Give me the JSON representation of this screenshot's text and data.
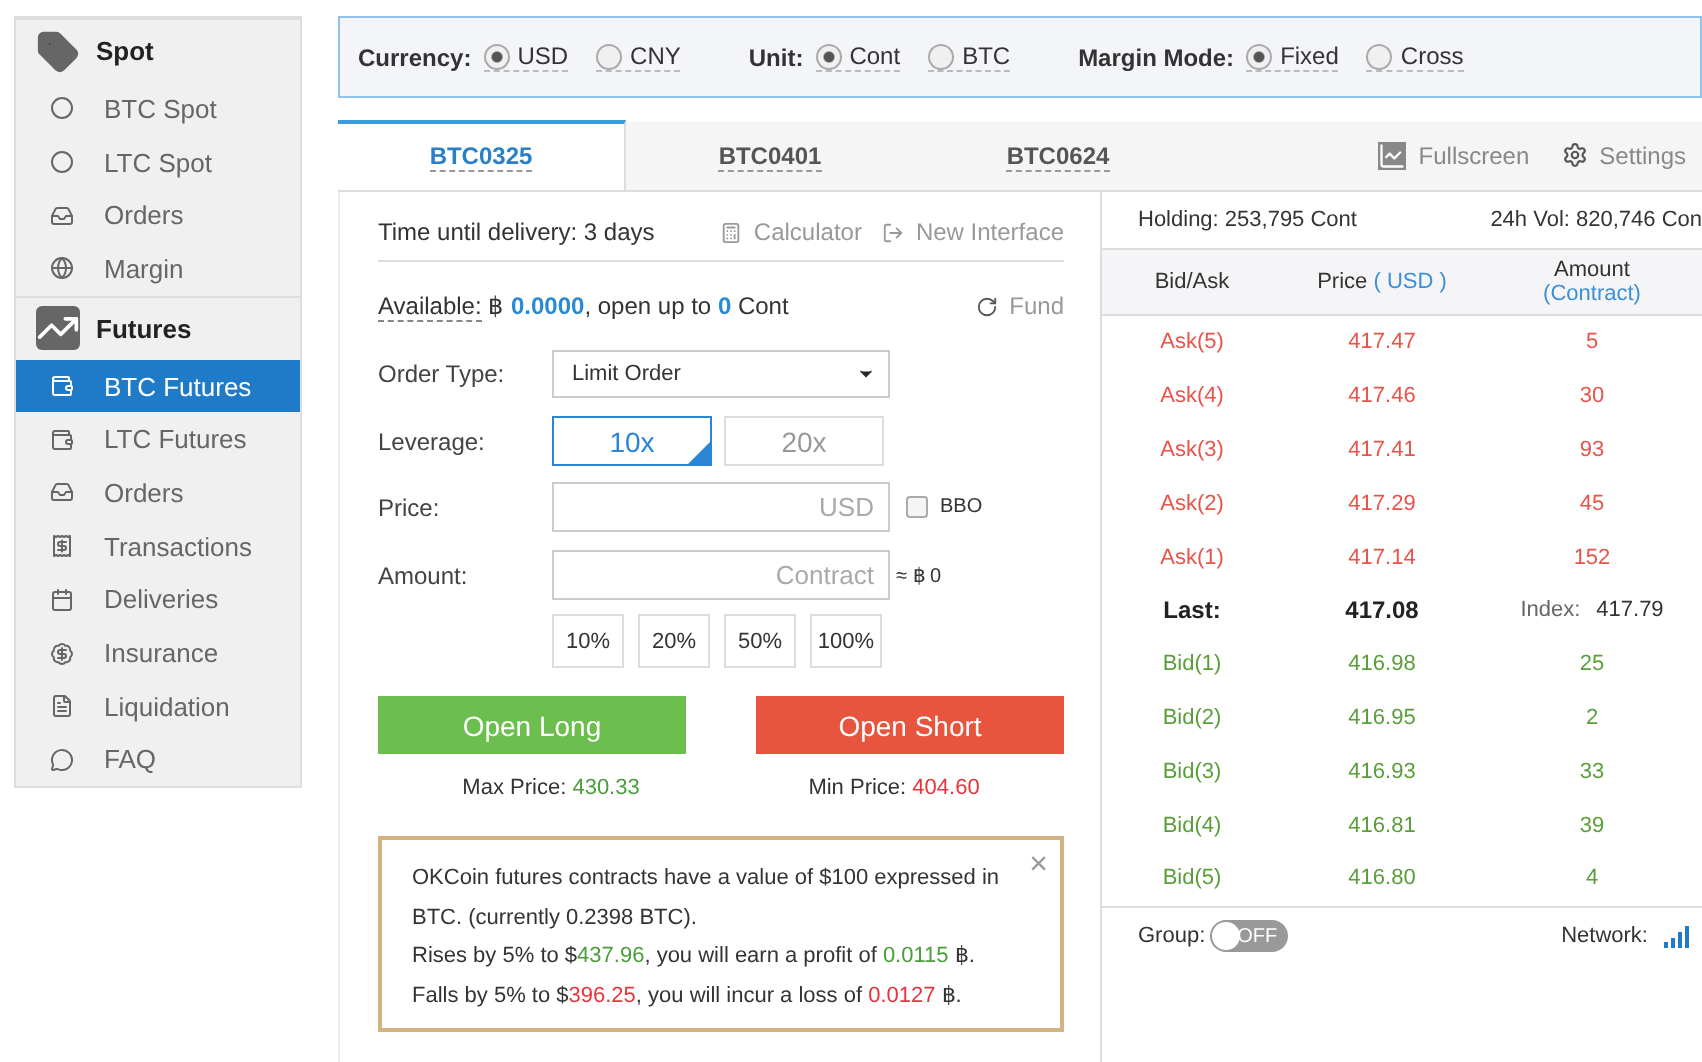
{
  "sidebar": {
    "sections": [
      {
        "title": "Spot",
        "items": [
          {
            "label": "BTC Spot",
            "selected": false
          },
          {
            "label": "LTC Spot",
            "selected": false
          },
          {
            "label": "Orders",
            "selected": false
          },
          {
            "label": "Margin",
            "selected": false
          }
        ]
      },
      {
        "title": "Futures",
        "items": [
          {
            "label": "BTC Futures",
            "selected": true
          },
          {
            "label": "LTC Futures",
            "selected": false
          },
          {
            "label": "Orders",
            "selected": false
          },
          {
            "label": "Transactions",
            "selected": false
          },
          {
            "label": "Deliveries",
            "selected": false
          },
          {
            "label": "Insurance",
            "selected": false
          },
          {
            "label": "Liquidation",
            "selected": false
          },
          {
            "label": "FAQ",
            "selected": false
          }
        ]
      }
    ]
  },
  "options": [
    {
      "label": "Currency:",
      "choices": [
        {
          "label": "USD",
          "selected": true
        },
        {
          "label": "CNY",
          "selected": false
        }
      ]
    },
    {
      "label": "Unit:",
      "choices": [
        {
          "label": "Cont",
          "selected": true
        },
        {
          "label": "BTC",
          "selected": false
        }
      ]
    },
    {
      "label": "Margin Mode:",
      "choices": [
        {
          "label": "Fixed",
          "selected": true
        },
        {
          "label": "Cross",
          "selected": false
        }
      ]
    }
  ],
  "tabs": [
    {
      "label": "BTC0325",
      "selected": true
    },
    {
      "label": "BTC0401",
      "selected": false
    },
    {
      "label": "BTC0624",
      "selected": false
    }
  ],
  "tab_actions": {
    "fullscreen": "Fullscreen",
    "settings": "Settings"
  },
  "order_form": {
    "delivery": "Time until delivery: 3 days",
    "calculator": "Calculator",
    "new_interface": "New Interface",
    "available": [
      {
        "text": "Available:",
        "kind": "label"
      },
      {
        "text": " ฿ ",
        "kind": "plain"
      },
      {
        "text": "0.0000",
        "kind": "value"
      },
      {
        "text": ", open up to ",
        "kind": "plain"
      },
      {
        "text": "0",
        "kind": "value"
      },
      {
        "text": " Cont",
        "kind": "plain"
      }
    ],
    "fund": "Fund",
    "order_type_label": "Order Type:",
    "order_type": "Limit Order",
    "leverage_label": "Leverage:",
    "leverage": [
      {
        "label": "10x",
        "selected": true
      },
      {
        "label": "20x",
        "selected": false
      }
    ],
    "price_label": "Price:",
    "price_placeholder": "USD",
    "bbo": {
      "label": "BBO",
      "checked": false
    },
    "amount_label": "Amount:",
    "amount_placeholder": "Contract",
    "amount_estimate": "≈ ฿ 0",
    "percents": [
      "10%",
      "20%",
      "50%",
      "100%"
    ],
    "open_long": "Open Long",
    "open_short": "Open Short",
    "max_price_label": "Max Price:",
    "max_price": "430.33",
    "min_price_label": "Min Price:",
    "min_price": "404.60"
  },
  "info": {
    "close": "×",
    "lines": [
      [
        {
          "text": "OKCoin futures contracts have a value of $100 expressed in BTC. (currently 0.2398 BTC).",
          "kind": "plain"
        }
      ],
      [
        {
          "text": "Rises by 5% to $",
          "kind": "plain"
        },
        {
          "text": "437.96",
          "kind": "up"
        },
        {
          "text": ", you will earn a profit of ",
          "kind": "plain"
        },
        {
          "text": "0.0115",
          "kind": "up"
        },
        {
          "text": " ฿.",
          "kind": "plain"
        }
      ],
      [
        {
          "text": "Falls by 5% to $",
          "kind": "plain"
        },
        {
          "text": "396.25",
          "kind": "down"
        },
        {
          "text": ", you will incur a loss of ",
          "kind": "plain"
        },
        {
          "text": "0.0127",
          "kind": "down"
        },
        {
          "text": " ฿.",
          "kind": "plain"
        }
      ]
    ]
  },
  "order_book": {
    "holding": "Holding:  253,795 Cont",
    "volume": "24h Vol:  820,746 Con",
    "columns": [
      {
        "label": "Bid/Ask"
      },
      {
        "label": "Price",
        "unit": "( USD )"
      },
      {
        "label": "Amount",
        "unit": "(Contract)"
      }
    ],
    "rows": [
      {
        "kind": "ask",
        "side": "Ask(5)",
        "price": "417.47",
        "amount": "5"
      },
      {
        "kind": "ask",
        "side": "Ask(4)",
        "price": "417.46",
        "amount": "30"
      },
      {
        "kind": "ask",
        "side": "Ask(3)",
        "price": "417.41",
        "amount": "93"
      },
      {
        "kind": "ask",
        "side": "Ask(2)",
        "price": "417.29",
        "amount": "45"
      },
      {
        "kind": "ask",
        "side": "Ask(1)",
        "price": "417.14",
        "amount": "152"
      },
      {
        "kind": "last",
        "side": "Last:",
        "price": "417.08",
        "index_label": "Index:",
        "index": "417.79"
      },
      {
        "kind": "bid",
        "side": "Bid(1)",
        "price": "416.98",
        "amount": "25"
      },
      {
        "kind": "bid",
        "side": "Bid(2)",
        "price": "416.95",
        "amount": "2"
      },
      {
        "kind": "bid",
        "side": "Bid(3)",
        "price": "416.93",
        "amount": "33"
      },
      {
        "kind": "bid",
        "side": "Bid(4)",
        "price": "416.81",
        "amount": "39"
      },
      {
        "kind": "bid",
        "side": "Bid(5)",
        "price": "416.80",
        "amount": "4"
      }
    ],
    "group_label": "Group:",
    "group_toggle": {
      "label": "OFF",
      "on": false
    },
    "network_label": "Network:"
  }
}
